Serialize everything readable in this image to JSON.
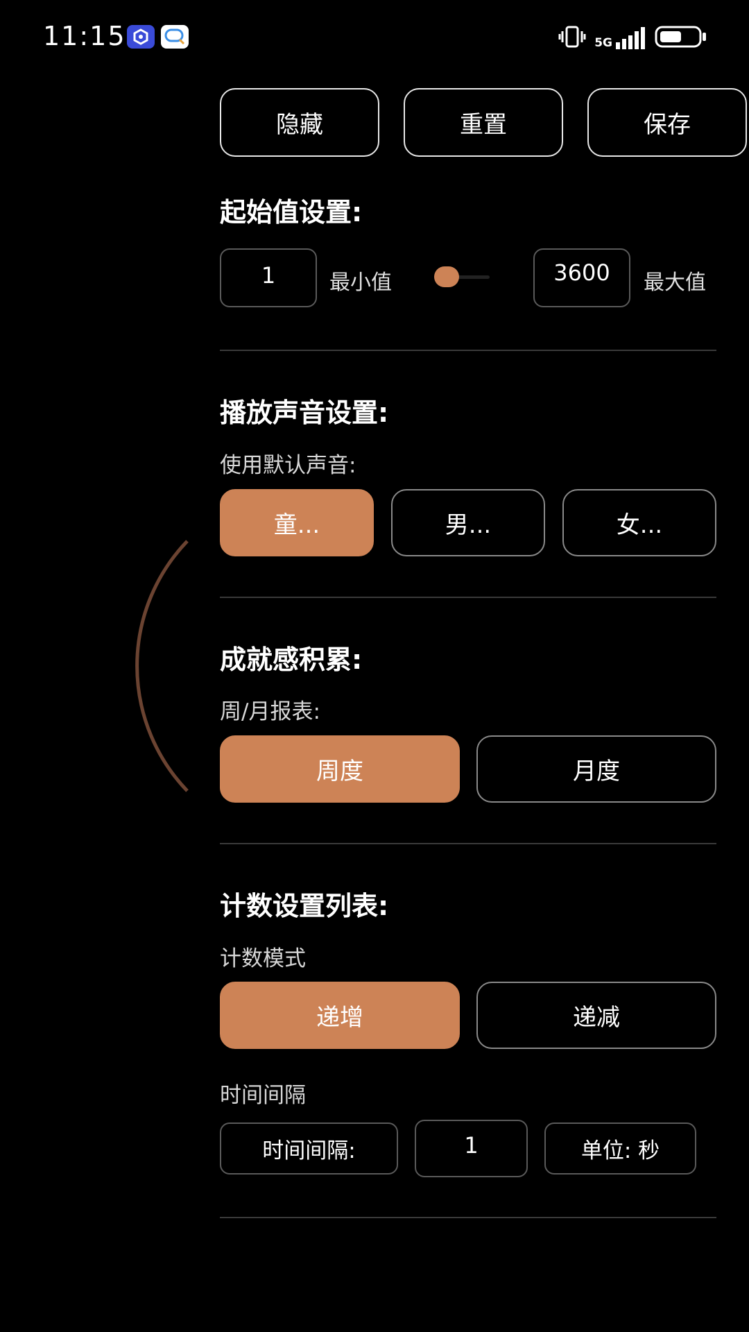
{
  "status_bar": {
    "time": "11:15",
    "network": "5G",
    "icons": [
      "vibrate-icon",
      "signal-icon",
      "battery-icon"
    ]
  },
  "toolbar": {
    "hide_label": "隐藏",
    "reset_label": "重置",
    "save_label": "保存"
  },
  "start_value": {
    "title": "起始值设置:",
    "min_value": "1",
    "min_label": "最小值",
    "max_value": "3600",
    "max_label": "最大值",
    "slider_fraction": 0
  },
  "sound": {
    "title": "播放声音设置:",
    "subtitle": "使用默认声音:",
    "options": [
      "童...",
      "男...",
      "女..."
    ],
    "selected_index": 0
  },
  "achievement": {
    "title": "成就感积累:",
    "subtitle": "周/月报表:",
    "options": [
      "周度",
      "月度"
    ],
    "selected_index": 0
  },
  "counting": {
    "title": "计数设置列表:",
    "mode_label": "计数模式",
    "mode_options": [
      "递增",
      "递减"
    ],
    "selected_index": 0,
    "interval_section_label": "时间间隔",
    "interval_prefix": "时间间隔:",
    "interval_value": "1",
    "unit_label": "单位: 秒"
  },
  "colors": {
    "accent": "#cd8356",
    "background": "#000000",
    "arc": "#6b4331"
  }
}
